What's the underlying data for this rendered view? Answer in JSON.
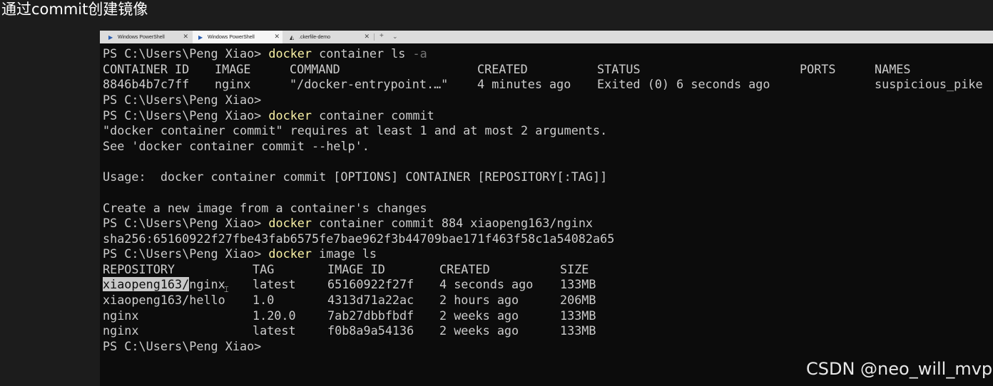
{
  "slide_title": "通过commit创建镜像",
  "tabs": [
    {
      "label": "Windows PowerShell"
    },
    {
      "label": "Windows PowerShell"
    },
    {
      "label": ".ckerfile-demo"
    }
  ],
  "prompt": "PS C:\\Users\\Peng Xiao>",
  "cmd1": {
    "word": "docker",
    "rest": " container ls ",
    "flag": "-a"
  },
  "ps_header": [
    "CONTAINER ID",
    "IMAGE",
    "COMMAND",
    "CREATED",
    "STATUS",
    "PORTS",
    "NAMES"
  ],
  "ps_row": [
    "8846b4b7c7ff",
    "nginx",
    "\"/docker-entrypoint.…\"",
    "4 minutes ago",
    "Exited (0) 6 seconds ago",
    "",
    "suspicious_pike"
  ],
  "cmd2": {
    "word": "docker",
    "rest": " container commit"
  },
  "err1": "\"docker container commit\" requires at least 1 and at most 2 arguments.",
  "err2": "See 'docker container commit --help'.",
  "usage": "Usage:  docker container commit [OPTIONS] CONTAINER [REPOSITORY[:TAG]]",
  "desc": "Create a new image from a container's changes",
  "cmd3": {
    "word": "docker",
    "rest": " container commit 884 xiaopeng163/nginx"
  },
  "sha": "sha256:65160922f27fbe43fab6575fe7bae962f3b44709bae171f463f58c1a54082a65",
  "cmd4": {
    "word": "docker",
    "rest": " image ls"
  },
  "img_header": [
    "REPOSITORY",
    "TAG",
    "IMAGE ID",
    "CREATED",
    "SIZE"
  ],
  "img_rows": [
    {
      "repo_sel": "xiaopeng163/",
      "repo_rest": "nginx",
      "tag": "latest",
      "id": "65160922f27f",
      "created": "4 seconds ago",
      "size": "133MB"
    },
    {
      "repo": "xiaopeng163/hello",
      "tag": "1.0",
      "id": "4313d71a22ac",
      "created": "2 hours ago",
      "size": "206MB"
    },
    {
      "repo": "nginx",
      "tag": "1.20.0",
      "id": "7ab27dbbfbdf",
      "created": "2 weeks ago",
      "size": "133MB"
    },
    {
      "repo": "nginx",
      "tag": "latest",
      "id": "f0b8a9a54136",
      "created": "2 weeks ago",
      "size": "133MB"
    }
  ],
  "watermark": "CSDN @neo_will_mvp",
  "colors": {
    "terminal_bg": "#0c0c0c",
    "text": "#cccccc",
    "command": "#f9f1a5",
    "flag": "#767676"
  }
}
